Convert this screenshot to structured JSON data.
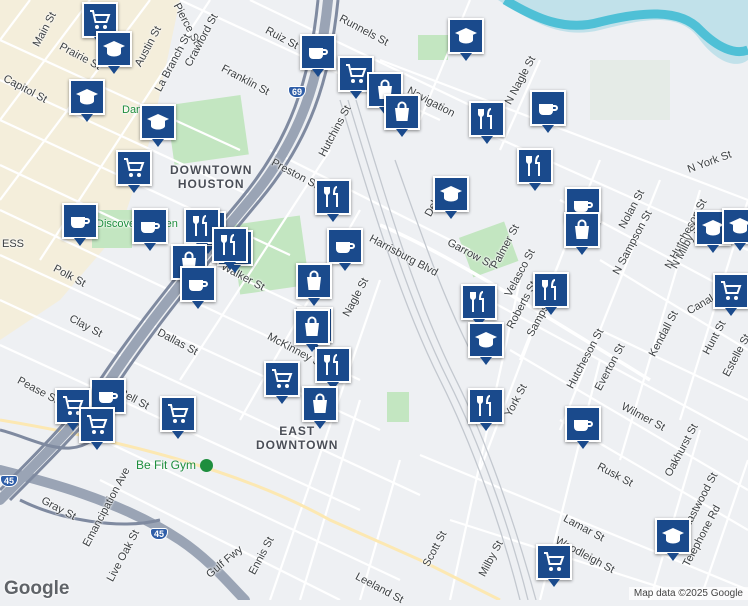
{
  "map": {
    "areas": [
      {
        "text": "DOWNTOWN\nHOUSTON"
      },
      {
        "text": "EAST\nDOWNTOWN"
      }
    ],
    "streets": [
      "Pierce St",
      "Runnels St",
      "Main St",
      "Prairie St",
      "Austin St",
      "La Branch St",
      "Crawford St",
      "Capitol St",
      "Franklin St",
      "Ruiz St",
      "Navigation",
      "N Nagle St",
      "Hutchins St",
      "Preston St",
      "N York St",
      "Harrisburg Blvd",
      "Nolan St",
      "N Hutcheson St",
      "N Sampson St",
      "Polk St",
      "Clay St",
      "Walker St",
      "Dallas St",
      "Nagle St",
      "McKinney St",
      "Garrow St",
      "Palmer St",
      "Velasco St",
      "Roberts St",
      "Sampson St",
      "Canal St",
      "N Milby St",
      "Kendall St",
      "Hunt St",
      "Estelle St",
      "Hutcheson St",
      "Everton St",
      "Wilmer St",
      "Pease St",
      "Bell St",
      "Leeland St",
      "York St",
      "Rusk St",
      "Oakhurst St",
      "Lamar St",
      "Woodleigh St",
      "Eastwood St",
      "Gray St",
      "Emancipation Ave",
      "Live Oak St",
      "Ennis St",
      "Scott St",
      "Milby St",
      "Gulf Fwy",
      "Telephone Rd",
      "Delano",
      "Dan Park",
      "Discovery Green",
      "ESS"
    ],
    "highways": [
      "69",
      "45",
      "45"
    ],
    "poi_label": "Be Fit Gym",
    "markers": [
      {
        "type": "shopping-cart"
      },
      {
        "type": "school"
      },
      {
        "type": "coffee"
      },
      {
        "type": "shopping-cart"
      },
      {
        "type": "school"
      },
      {
        "type": "shopping-bag"
      },
      {
        "type": "shopping-bag"
      },
      {
        "type": "school"
      },
      {
        "type": "school"
      },
      {
        "type": "restaurant"
      },
      {
        "type": "coffee"
      },
      {
        "type": "shopping-cart"
      },
      {
        "type": "restaurant"
      },
      {
        "type": "restaurant"
      },
      {
        "type": "school"
      },
      {
        "type": "coffee"
      },
      {
        "type": "coffee"
      },
      {
        "type": "coffee"
      },
      {
        "type": "restaurant"
      },
      {
        "type": "restaurant"
      },
      {
        "type": "restaurant"
      },
      {
        "type": "coffee"
      },
      {
        "type": "shopping-bag"
      },
      {
        "type": "shopping-bag"
      },
      {
        "type": "coffee"
      },
      {
        "type": "restaurant"
      },
      {
        "type": "restaurant"
      },
      {
        "type": "shopping-bag"
      },
      {
        "type": "restaurant"
      },
      {
        "type": "school"
      },
      {
        "type": "shopping-bag"
      },
      {
        "type": "restaurant"
      },
      {
        "type": "restaurant"
      },
      {
        "type": "school"
      },
      {
        "type": "school"
      },
      {
        "type": "shopping-cart"
      },
      {
        "type": "shopping-cart"
      },
      {
        "type": "coffee"
      },
      {
        "type": "shopping-cart"
      },
      {
        "type": "shopping-cart"
      },
      {
        "type": "shopping-cart"
      },
      {
        "type": "shopping-bag"
      },
      {
        "type": "restaurant"
      },
      {
        "type": "coffee"
      },
      {
        "type": "school"
      },
      {
        "type": "shopping-cart"
      }
    ]
  },
  "footer": {
    "logo": "Google",
    "attribution": "Map data ©2025 Google"
  }
}
